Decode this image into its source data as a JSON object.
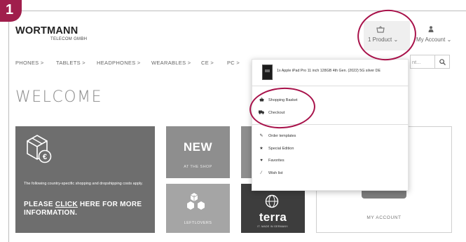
{
  "step_number": "1",
  "brand": {
    "name": "WORTMANN",
    "subtitle": "TELECOM GMBH"
  },
  "header": {
    "cart_label": "1 Product",
    "account_label": "My Account"
  },
  "nav": [
    "PHONES >",
    "TABLETS >",
    "HEADPHONES >",
    "WEARABLES >",
    "CE >",
    "PC >"
  ],
  "search": {
    "visible_text": "nt..."
  },
  "welcome": "WELCOME",
  "promo": {
    "text": "The following country-specific shopping and dropshipping costs apply.",
    "cta_pre": "PLEASE ",
    "cta_link": "CLICK",
    "cta_post": " HERE FOR MORE INFORMATION."
  },
  "tiles": {
    "new_title": "NEW",
    "new_subtitle": "AT THE SHOP",
    "leftlovers": "LEFTLOVERS",
    "terra_word": "terra",
    "terra_sub": "IT. MADE IN GERMANY.",
    "account": "MY ACCOUNT"
  },
  "dropdown": {
    "product": "1x Apple iPad Pro 11 inch 128GB 4th Gen. (2022) 5G silver DE",
    "items": {
      "basket": "Shopping Basket",
      "checkout": "Checkout",
      "order_templates": "Order templates",
      "special_edition": "Special Edition",
      "favorites": "Favorites",
      "wish_list": "Wish list"
    }
  },
  "colors": {
    "annotation": "#a8124a",
    "badge": "#a01e4c"
  }
}
